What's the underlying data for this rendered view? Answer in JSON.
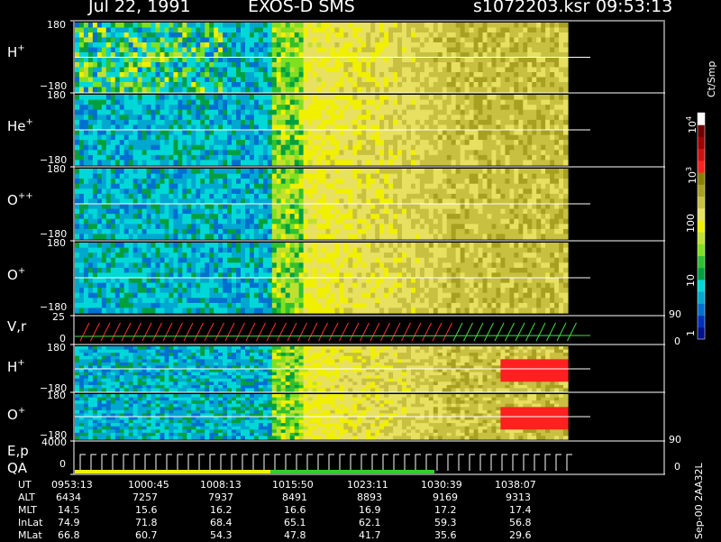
{
  "header": {
    "date": "Jul 22, 1991",
    "instrument": "EXOS-D SMS",
    "file": "s1072203.ksr",
    "time": "09:53:13"
  },
  "colorbar": {
    "unit_label": "Ct/Smp",
    "ticks": [
      "1",
      "10",
      "100",
      "10",
      "10"
    ],
    "tick_exponents": [
      "",
      "",
      "",
      "3",
      "4"
    ],
    "colors": [
      "#00108a",
      "#0030c0",
      "#0070d0",
      "#00a8d0",
      "#00d8d8",
      "#00a040",
      "#30c030",
      "#80e020",
      "#c0e030",
      "#f0f000",
      "#e8e060",
      "#c8c040",
      "#a8a020",
      "#888000",
      "#ff2020",
      "#d01010",
      "#a00000",
      "#700000",
      "#ffffff"
    ]
  },
  "panels": [
    {
      "label": "H",
      "charge": "+",
      "top": "180",
      "bottom": "−180"
    },
    {
      "label": "He",
      "charge": "+",
      "top": "180",
      "bottom": "−180"
    },
    {
      "label": "O",
      "charge": "++",
      "top": "180",
      "bottom": "−180"
    },
    {
      "label": "O",
      "charge": "+",
      "top": "180",
      "bottom": "−180"
    },
    {
      "label": "V,r",
      "charge": "",
      "top": "25",
      "bottom": "0",
      "right_top": "90",
      "right_bottom": "0"
    },
    {
      "label": "H",
      "charge": "+",
      "top": "180",
      "bottom": "−180"
    },
    {
      "label": "O",
      "charge": "+",
      "top": "180",
      "bottom": "−180"
    },
    {
      "label": "E,p",
      "charge": "",
      "label2": "QA",
      "top": "4000",
      "bottom": "0",
      "right_top": "90",
      "right_bottom": "0"
    }
  ],
  "footer": {
    "rows": [
      {
        "name": "UT",
        "values": [
          "0953:13",
          "1000:45",
          "1008:13",
          "1015:50",
          "1023:11",
          "1030:39",
          "1038:07"
        ]
      },
      {
        "name": "ALT",
        "values": [
          "6434",
          "7257",
          "7937",
          "8491",
          "8893",
          "9169",
          "9313"
        ]
      },
      {
        "name": "MLT",
        "values": [
          "14.5",
          "15.6",
          "16.2",
          "16.6",
          "16.9",
          "17.2",
          "17.4"
        ]
      },
      {
        "name": "InLat",
        "values": [
          "74.9",
          "71.8",
          "68.4",
          "65.1",
          "62.1",
          "59.3",
          "56.8"
        ]
      },
      {
        "name": "MLat",
        "values": [
          "66.8",
          "60.7",
          "54.3",
          "47.8",
          "41.7",
          "35.6",
          "29.6"
        ]
      }
    ],
    "stamp": "Sep-00 2AA32L"
  },
  "chart_data": {
    "type": "heatmap",
    "title": "Jul 22, 1991   EXOS-D SMS",
    "xlabel": "UT",
    "x_ticks": [
      "0953:13",
      "1000:45",
      "1008:13",
      "1015:50",
      "1023:11",
      "1030:39",
      "1038:07"
    ],
    "colorbar_label": "Ct/Smp",
    "colorbar_scale": "log",
    "colorbar_range": [
      1,
      10000
    ],
    "series": [
      {
        "name": "H+",
        "ylim": [
          -180,
          180
        ]
      },
      {
        "name": "He+",
        "ylim": [
          -180,
          180
        ]
      },
      {
        "name": "O++",
        "ylim": [
          -180,
          180
        ]
      },
      {
        "name": "O+",
        "ylim": [
          -180,
          180
        ]
      },
      {
        "name": "V,r",
        "ylim": [
          0,
          25
        ],
        "right_ylim": [
          0,
          90
        ]
      },
      {
        "name": "H+",
        "ylim": [
          -180,
          180
        ]
      },
      {
        "name": "O+",
        "ylim": [
          -180,
          180
        ]
      },
      {
        "name": "E,p QA",
        "ylim": [
          0,
          4000
        ],
        "right_ylim": [
          0,
          90
        ]
      }
    ]
  }
}
